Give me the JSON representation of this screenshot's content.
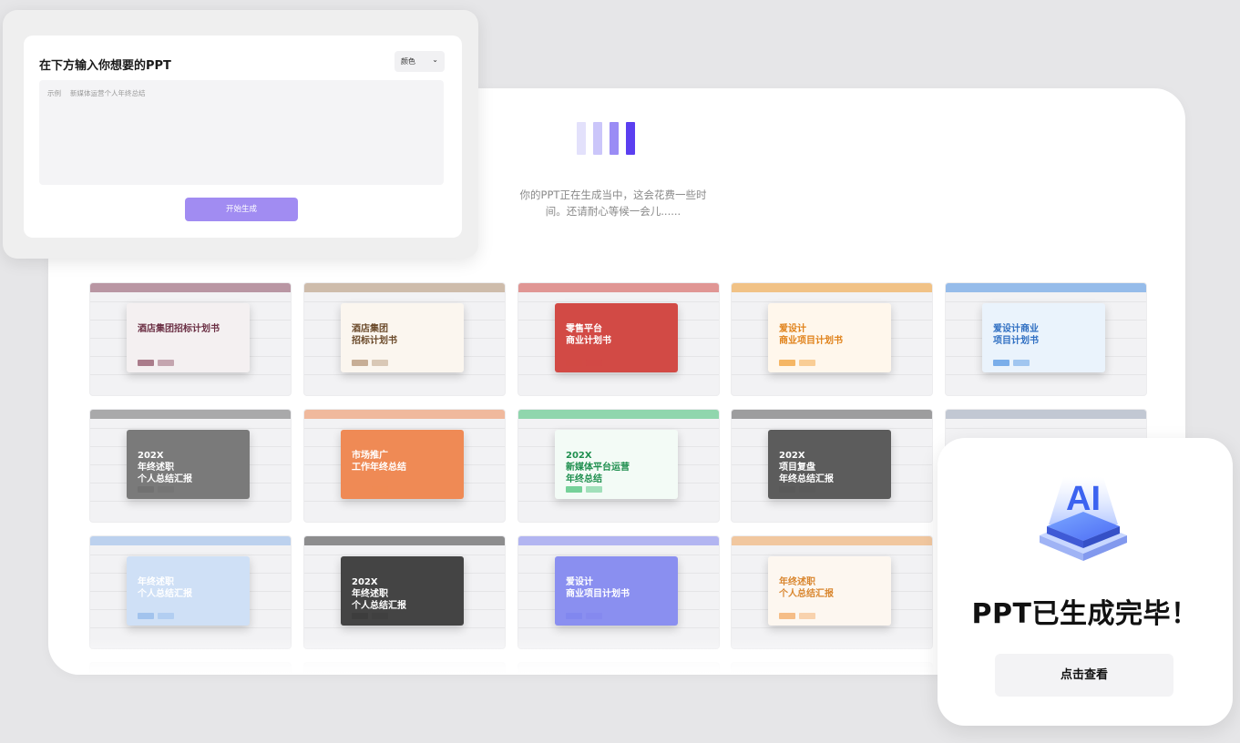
{
  "input_panel": {
    "title": "在下方输入你想要的PPT",
    "color_select": {
      "label": "颜色",
      "icon": "chevron-down-icon"
    },
    "prompt": {
      "example_label": "示例",
      "placeholder": "新媒体运营个人年终总结"
    },
    "generate_button": "开始生成"
  },
  "progress": {
    "loader_colors": [
      "#e3e1fb",
      "#cbc6fa",
      "#9a8cf5",
      "#5b3ff0"
    ],
    "message_line1": "你的PPT正在生成当中，这会花费一些时",
    "message_line2": "间。还请耐心等候一会儿......"
  },
  "templates": [
    {
      "title": "酒店集团招标计划书",
      "theme": "#8a4a60",
      "slide_bg": "#f4f0f1",
      "title_color": "#6b2f44"
    },
    {
      "title": "酒店集团\n招标计划书",
      "theme": "#b09070",
      "slide_bg": "#fbf6ef",
      "title_color": "#6b4a2a"
    },
    {
      "title": "零售平台\n商业计划书",
      "theme": "#d24a45",
      "slide_bg": "#d24a45",
      "title_color": "#ffffff"
    },
    {
      "title": "爱设计\n商业项目计划书",
      "theme": "#f19a2c",
      "slide_bg": "#fff7ec",
      "title_color": "#e0821a"
    },
    {
      "title": "爱设计商业\n项目计划书",
      "theme": "#4a90e2",
      "slide_bg": "#eaf3fc",
      "title_color": "#2f6fc2"
    },
    {
      "title": "202X\n年终述职\n个人总结汇报",
      "theme": "#6e6e6e",
      "slide_bg": "#7a7a7a",
      "title_color": "#ffffff"
    },
    {
      "title": "市场推广\n工作年终总结",
      "theme": "#ef8a55",
      "slide_bg": "#ef8a55",
      "title_color": "#ffffff"
    },
    {
      "title": "202X\n新媒体平台运营\n年终总结",
      "theme": "#3fbf72",
      "slide_bg": "#f3fbf6",
      "title_color": "#1f8f4f"
    },
    {
      "title": "202X\n项目复盘\n年终总结汇报",
      "theme": "#585858",
      "slide_bg": "#5c5c5c",
      "title_color": "#ffffff"
    },
    {
      "title": "",
      "theme": "#9aa6b8",
      "slide_bg": "#eef1f6",
      "title_color": "#5b6b82"
    },
    {
      "title": "年终述职\n个人总结汇报",
      "theme": "#8fb7ea",
      "slide_bg": "#cfe0f6",
      "title_color": "#ffffff"
    },
    {
      "title": "202X\n年终述职\n个人总结汇报",
      "theme": "#3b3b3b",
      "slide_bg": "#444444",
      "title_color": "#ffffff"
    },
    {
      "title": "爱设计\n商业项目计划书",
      "theme": "#7e83ee",
      "slide_bg": "#8a8ff0",
      "title_color": "#ffffff"
    },
    {
      "title": "年终述职\n个人总结汇报",
      "theme": "#f1a45a",
      "slide_bg": "#fdf7f0",
      "title_color": "#d9862e"
    },
    {
      "title": "",
      "theme": "#cfcfd4",
      "slide_bg": "#f4f4f6",
      "title_color": "#999999"
    }
  ],
  "done_card": {
    "icon": "ai-chip-icon",
    "icon_text": "AI",
    "title": "PPT已生成完毕！",
    "view_button": "点击查看"
  }
}
